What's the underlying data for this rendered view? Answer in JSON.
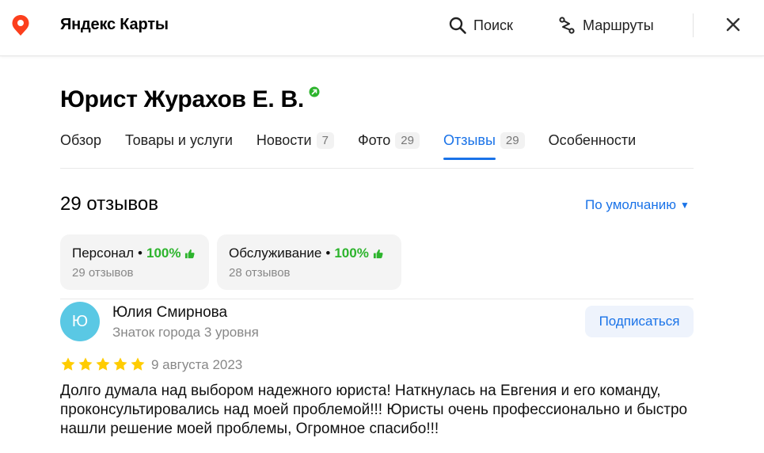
{
  "app": {
    "name": "Яндекс Карты",
    "accent": "#1a73e8",
    "pin_color": "#fc3f1d"
  },
  "topbar": {
    "search_label": "Поиск",
    "routes_label": "Маршруты"
  },
  "org": {
    "title": "Юрист Журахов Е. В."
  },
  "tabs": [
    {
      "label": "Обзор",
      "count": null,
      "active": false
    },
    {
      "label": "Товары и услуги",
      "count": null,
      "active": false
    },
    {
      "label": "Новости",
      "count": "7",
      "active": false
    },
    {
      "label": "Фото",
      "count": "29",
      "active": false
    },
    {
      "label": "Отзывы",
      "count": "29",
      "active": true
    },
    {
      "label": "Особенности",
      "count": null,
      "active": false
    }
  ],
  "reviews": {
    "count_label": "29 отзывов",
    "sort_label": "По умолчанию",
    "aspects": [
      {
        "name": "Персонал",
        "percent": "100%",
        "count": "29 отзывов"
      },
      {
        "name": "Обслуживание",
        "percent": "100%",
        "count": "28 отзывов"
      }
    ],
    "items": [
      {
        "avatar_letter": "Ю",
        "author": "Юлия Смирнова",
        "level": "Знаток города 3 уровня",
        "subscribe_label": "Подписаться",
        "rating": 5,
        "date": "9 августа 2023",
        "text": "Долго думала над выбором надежного юриста! Наткнулась на Евгения и его команду, проконсультировались над моей проблемой!!! Юристы очень профессионально и быстро нашли решение моей проблемы, Огромное спасибо!!!"
      }
    ]
  },
  "icons": {
    "pin": "map-pin-icon",
    "search": "search-icon",
    "routes": "routes-icon",
    "close": "close-icon",
    "verified": "verified-icon",
    "thumb": "thumb-up-icon",
    "star": "star-icon",
    "sort": "triangle-down-icon"
  }
}
